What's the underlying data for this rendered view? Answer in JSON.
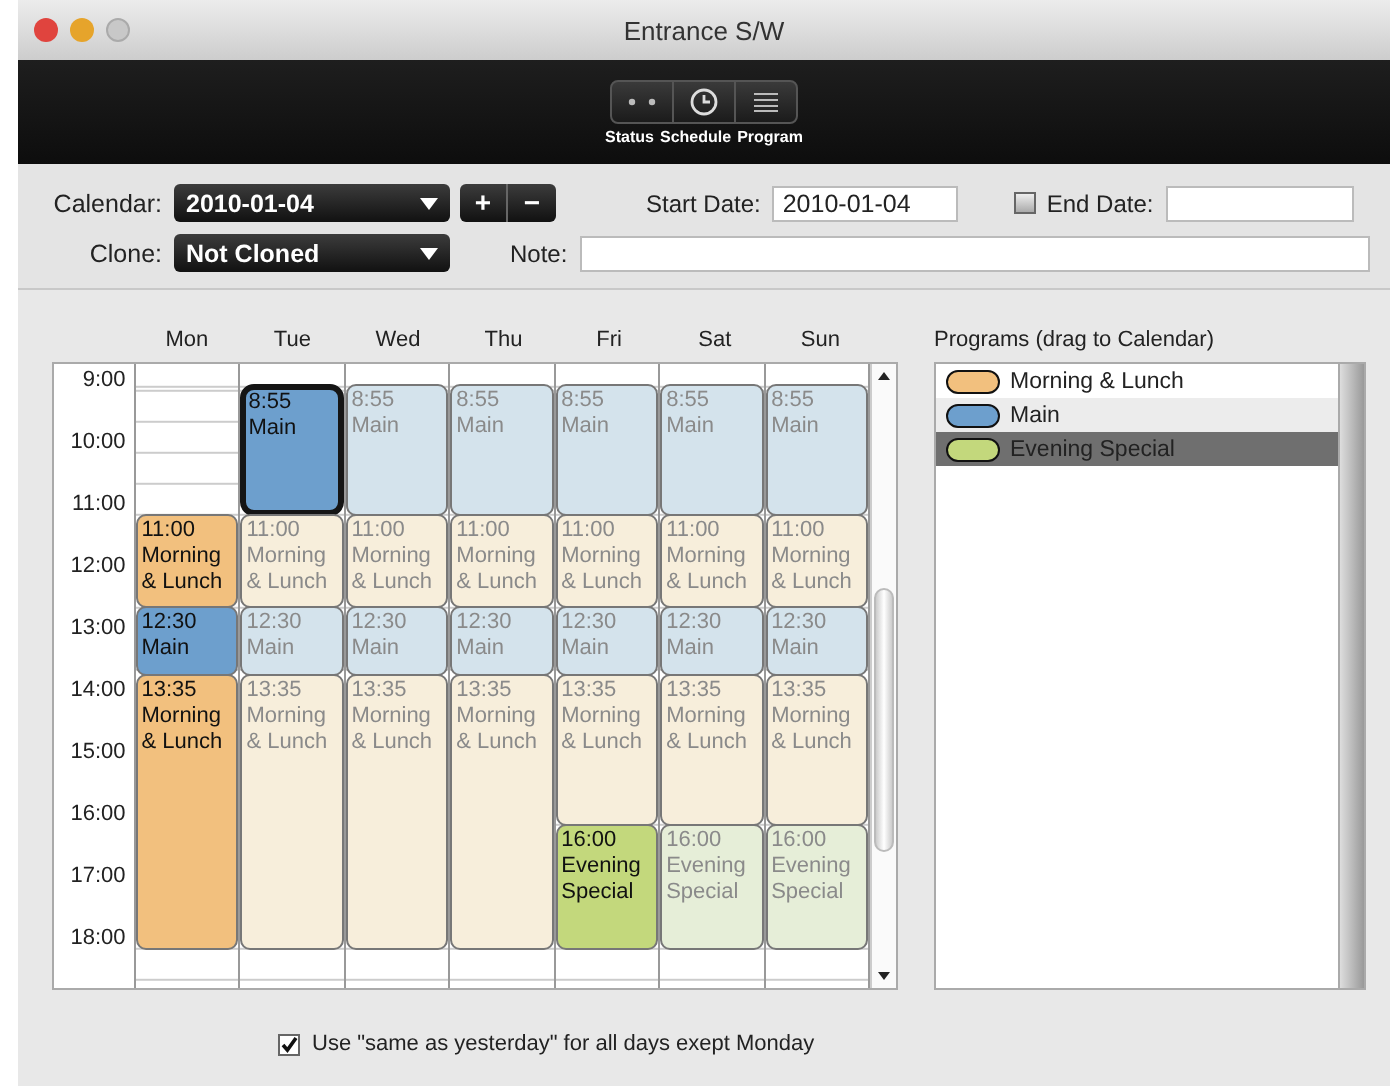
{
  "window": {
    "title": "Entrance S/W"
  },
  "toolbar": [
    {
      "kind": "dots",
      "label": "Status"
    },
    {
      "kind": "clock",
      "label": "Schedule"
    },
    {
      "kind": "lines",
      "label": "Program"
    }
  ],
  "form": {
    "calendar_label": "Calendar:",
    "calendar_value": "2010-01-04",
    "add": "+",
    "remove": "−",
    "start_label": "Start Date:",
    "start_value": "2010-01-04",
    "end_checked": false,
    "end_label": "End Date:",
    "clone_label": "Clone:",
    "clone_value": "Not Cloned",
    "note_label": "Note:"
  },
  "hours": [
    "9:00",
    "10:00",
    "11:00",
    "12:00",
    "13:00",
    "14:00",
    "15:00",
    "16:00",
    "17:00",
    "18:00"
  ],
  "days": [
    {
      "label": "Mon",
      "events": [
        {
          "start": "11:00",
          "name": "Morning & Lunch",
          "color": "#f2c07e",
          "inherited": false,
          "selected": false
        },
        {
          "start": "12:30",
          "name": "Main",
          "color": "#6d9fcd",
          "inherited": false,
          "selected": false
        },
        {
          "start": "13:35",
          "name": "Morning & Lunch",
          "color": "#f2c07e",
          "inherited": false,
          "selected": false
        }
      ]
    },
    {
      "label": "Tue",
      "events": [
        {
          "start": "8:55",
          "name": "Main",
          "color": "#6d9fcd",
          "inherited": false,
          "selected": true
        },
        {
          "start": "11:00",
          "name": "Morning & Lunch",
          "color": "#f7eedb",
          "inherited": true,
          "selected": false
        },
        {
          "start": "12:30",
          "name": "Main",
          "color": "#d4e3ec",
          "inherited": true,
          "selected": false
        },
        {
          "start": "13:35",
          "name": "Morning & Lunch",
          "color": "#f7eedb",
          "inherited": true,
          "selected": false
        }
      ]
    },
    {
      "label": "Wed",
      "events": [
        {
          "start": "8:55",
          "name": "Main",
          "color": "#d4e3ec",
          "inherited": true,
          "selected": false
        },
        {
          "start": "11:00",
          "name": "Morning & Lunch",
          "color": "#f7eedb",
          "inherited": true,
          "selected": false
        },
        {
          "start": "12:30",
          "name": "Main",
          "color": "#d4e3ec",
          "inherited": true,
          "selected": false
        },
        {
          "start": "13:35",
          "name": "Morning & Lunch",
          "color": "#f7eedb",
          "inherited": true,
          "selected": false
        }
      ]
    },
    {
      "label": "Thu",
      "events": [
        {
          "start": "8:55",
          "name": "Main",
          "color": "#d4e3ec",
          "inherited": true,
          "selected": false
        },
        {
          "start": "11:00",
          "name": "Morning & Lunch",
          "color": "#f7eedb",
          "inherited": true,
          "selected": false
        },
        {
          "start": "12:30",
          "name": "Main",
          "color": "#d4e3ec",
          "inherited": true,
          "selected": false
        },
        {
          "start": "13:35",
          "name": "Morning & Lunch",
          "color": "#f7eedb",
          "inherited": true,
          "selected": false
        }
      ]
    },
    {
      "label": "Fri",
      "events": [
        {
          "start": "8:55",
          "name": "Main",
          "color": "#d4e3ec",
          "inherited": true,
          "selected": false
        },
        {
          "start": "11:00",
          "name": "Morning & Lunch",
          "color": "#f7eedb",
          "inherited": true,
          "selected": false
        },
        {
          "start": "12:30",
          "name": "Main",
          "color": "#d4e3ec",
          "inherited": true,
          "selected": false
        },
        {
          "start": "13:35",
          "name": "Morning & Lunch",
          "color": "#f7eedb",
          "inherited": true,
          "selected": false
        },
        {
          "start": "16:00",
          "name": "Evening Special",
          "color": "#c3d87c",
          "inherited": false,
          "selected": false
        }
      ]
    },
    {
      "label": "Sat",
      "events": [
        {
          "start": "8:55",
          "name": "Main",
          "color": "#d4e3ec",
          "inherited": true,
          "selected": false
        },
        {
          "start": "11:00",
          "name": "Morning & Lunch",
          "color": "#f7eedb",
          "inherited": true,
          "selected": false
        },
        {
          "start": "12:30",
          "name": "Main",
          "color": "#d4e3ec",
          "inherited": true,
          "selected": false
        },
        {
          "start": "13:35",
          "name": "Morning & Lunch",
          "color": "#f7eedb",
          "inherited": true,
          "selected": false
        },
        {
          "start": "16:00",
          "name": "Evening Special",
          "color": "#e6eed8",
          "inherited": true,
          "selected": false
        }
      ]
    },
    {
      "label": "Sun",
      "events": [
        {
          "start": "8:55",
          "name": "Main",
          "color": "#d4e3ec",
          "inherited": true,
          "selected": false
        },
        {
          "start": "11:00",
          "name": "Morning & Lunch",
          "color": "#f7eedb",
          "inherited": true,
          "selected": false
        },
        {
          "start": "12:30",
          "name": "Main",
          "color": "#d4e3ec",
          "inherited": true,
          "selected": false
        },
        {
          "start": "13:35",
          "name": "Morning & Lunch",
          "color": "#f7eedb",
          "inherited": true,
          "selected": false
        },
        {
          "start": "16:00",
          "name": "Evening Special",
          "color": "#e6eed8",
          "inherited": true,
          "selected": false
        }
      ]
    }
  ],
  "programs": {
    "title": "Programs (drag to Calendar)",
    "items": [
      {
        "name": "Morning & Lunch",
        "color": "#f2c07e",
        "selected": false
      },
      {
        "name": "Main",
        "color": "#6d9fcd",
        "selected": false
      },
      {
        "name": "Evening Special",
        "color": "#c3d87c",
        "selected": true
      }
    ]
  },
  "same_as_yesterday": {
    "label": "Use \"same as yesterday\" for all days exept Monday",
    "checked": true
  }
}
